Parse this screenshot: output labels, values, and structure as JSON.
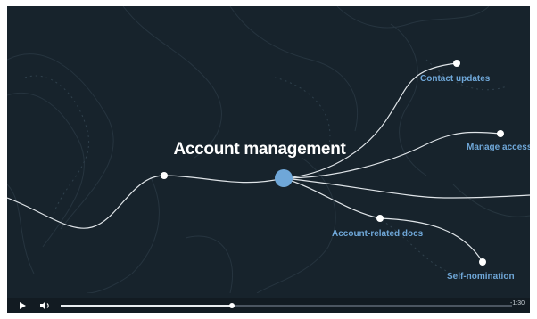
{
  "video": {
    "title": "Account management",
    "nodes": [
      {
        "id": "contact",
        "label": "Contact updates"
      },
      {
        "id": "access",
        "label": "Manage access"
      },
      {
        "id": "docs",
        "label": "Account-related docs"
      },
      {
        "id": "nomination",
        "label": "Self-nomination"
      }
    ]
  },
  "controls": {
    "play_icon": "play-icon",
    "volume_icon": "volume-icon",
    "progress_fraction": 0.38,
    "time_remaining": "-1:30"
  },
  "colors": {
    "background": "#17232c",
    "accent": "#6fa7d8",
    "line": "#dfe4e8"
  }
}
